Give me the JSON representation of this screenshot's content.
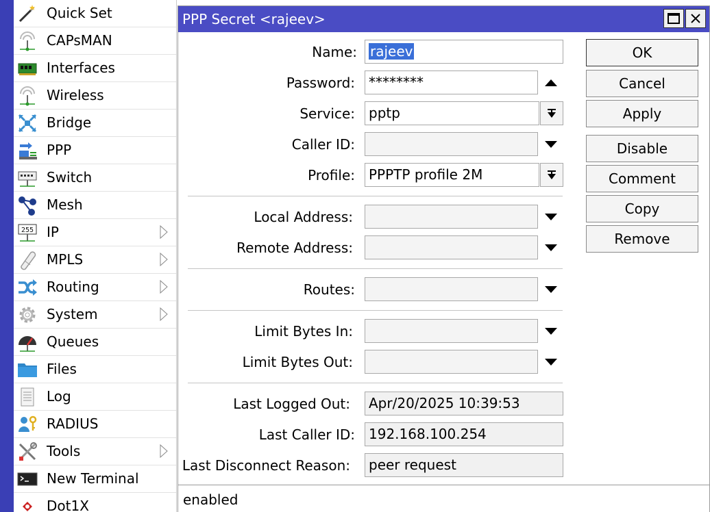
{
  "sidebar": {
    "items": [
      {
        "label": "Quick Set",
        "icon": "wand-icon"
      },
      {
        "label": "CAPsMAN",
        "icon": "antenna-icon"
      },
      {
        "label": "Interfaces",
        "icon": "nic-card-icon"
      },
      {
        "label": "Wireless",
        "icon": "wireless-icon"
      },
      {
        "label": "Bridge",
        "icon": "bridge-icon"
      },
      {
        "label": "PPP",
        "icon": "ppp-icon"
      },
      {
        "label": "Switch",
        "icon": "switch-icon"
      },
      {
        "label": "Mesh",
        "icon": "mesh-icon"
      },
      {
        "label": "IP",
        "icon": "ip-icon",
        "submenu": true
      },
      {
        "label": "MPLS",
        "icon": "mpls-icon",
        "submenu": true
      },
      {
        "label": "Routing",
        "icon": "routing-icon",
        "submenu": true
      },
      {
        "label": "System",
        "icon": "gear-icon",
        "submenu": true
      },
      {
        "label": "Queues",
        "icon": "gauge-icon"
      },
      {
        "label": "Files",
        "icon": "folder-icon"
      },
      {
        "label": "Log",
        "icon": "log-icon"
      },
      {
        "label": "RADIUS",
        "icon": "users-key-icon"
      },
      {
        "label": "Tools",
        "icon": "tools-icon",
        "submenu": true
      },
      {
        "label": "New Terminal",
        "icon": "terminal-icon"
      },
      {
        "label": "Dot1X",
        "icon": "dot1x-icon"
      }
    ]
  },
  "dialog": {
    "title": "PPP Secret <rajeev>",
    "fields": {
      "name": {
        "label": "Name:",
        "value": "rajeev"
      },
      "password": {
        "label": "Password:",
        "value": "********"
      },
      "service": {
        "label": "Service:",
        "value": "pptp"
      },
      "caller_id": {
        "label": "Caller ID:",
        "value": ""
      },
      "profile": {
        "label": "Profile:",
        "value": "PPPTP profile 2M"
      },
      "local_address": {
        "label": "Local Address:",
        "value": ""
      },
      "remote_address": {
        "label": "Remote Address:",
        "value": ""
      },
      "routes": {
        "label": "Routes:",
        "value": ""
      },
      "limit_bytes_in": {
        "label": "Limit Bytes In:",
        "value": ""
      },
      "limit_bytes_out": {
        "label": "Limit Bytes Out:",
        "value": ""
      },
      "last_logged_out": {
        "label": "Last Logged Out:",
        "value": "Apr/20/2025 10:39:53"
      },
      "last_caller_id": {
        "label": "Last Caller ID:",
        "value": "192.168.100.254"
      },
      "last_disconnect_reason": {
        "label": "Last Disconnect Reason:",
        "value": "peer request"
      }
    },
    "buttons": {
      "ok": "OK",
      "cancel": "Cancel",
      "apply": "Apply",
      "disable": "Disable",
      "comment": "Comment",
      "copy": "Copy",
      "remove": "Remove"
    },
    "status": "enabled"
  },
  "colors": {
    "titlebar": "#4a4cc4",
    "strip": "#3a3fb5",
    "selection": "#3a6fd8"
  }
}
